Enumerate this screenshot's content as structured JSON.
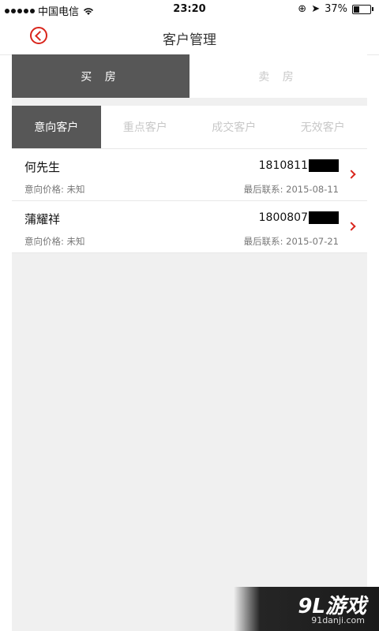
{
  "status_bar": {
    "carrier": "中国电信",
    "time": "23:20",
    "battery": "37%",
    "battery_level": 0.37
  },
  "header": {
    "title": "客户管理"
  },
  "mode_tabs": [
    {
      "label": "买 房",
      "active": true
    },
    {
      "label": "卖 房",
      "active": false
    }
  ],
  "category_tabs": [
    {
      "label": "意向客户",
      "active": true
    },
    {
      "label": "重点客户",
      "active": false
    },
    {
      "label": "成交客户",
      "active": false
    },
    {
      "label": "无效客户",
      "active": false
    }
  ],
  "customers": [
    {
      "name": "何先生",
      "phone": "1810811",
      "price": "意向价格: 未知",
      "last_contact": "最后联系: 2015-08-11"
    },
    {
      "name": "蒲耀祥",
      "phone": "1800807",
      "price": "意向价格: 未知",
      "last_contact": "最后联系: 2015-07-21"
    }
  ],
  "watermark": {
    "logo": "9L游戏",
    "url": "91danji.com"
  },
  "colors": {
    "accent": "#d9251c",
    "active_tab": "#575757",
    "background": "#f0f0f0"
  }
}
